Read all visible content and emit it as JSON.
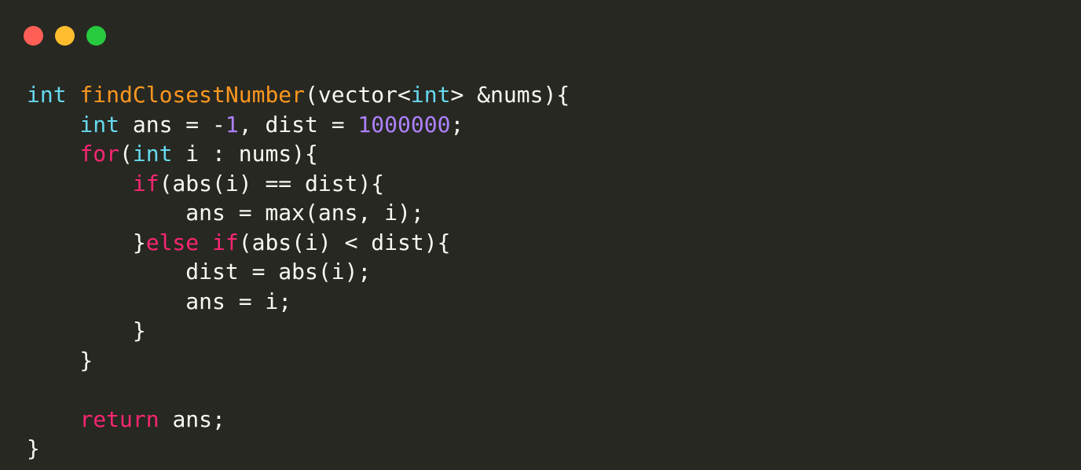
{
  "colors": {
    "background": "#272822",
    "text": "#f8f8f2",
    "type_keyword": "#66d9ef",
    "control_keyword": "#f92672",
    "function_name": "#fd971f",
    "number": "#ae81ff",
    "dot_close": "#ff5f56",
    "dot_minimize": "#ffbd2e",
    "dot_maximize": "#27c93f"
  },
  "code": {
    "lines": [
      [
        {
          "t": "int",
          "c": "kw-type"
        },
        {
          "t": " "
        },
        {
          "t": "findClosestNumber",
          "c": "fn"
        },
        {
          "t": "(vector<"
        },
        {
          "t": "int",
          "c": "kw-type"
        },
        {
          "t": "> &nums){"
        }
      ],
      [
        {
          "t": "    "
        },
        {
          "t": "int",
          "c": "kw-type"
        },
        {
          "t": " ans = -"
        },
        {
          "t": "1",
          "c": "num"
        },
        {
          "t": ", dist = "
        },
        {
          "t": "1000000",
          "c": "num"
        },
        {
          "t": ";"
        }
      ],
      [
        {
          "t": "    "
        },
        {
          "t": "for",
          "c": "kw-ctrl"
        },
        {
          "t": "("
        },
        {
          "t": "int",
          "c": "kw-type"
        },
        {
          "t": " i : nums){"
        }
      ],
      [
        {
          "t": "        "
        },
        {
          "t": "if",
          "c": "kw-ctrl"
        },
        {
          "t": "(abs(i) == dist){"
        }
      ],
      [
        {
          "t": "            ans = max(ans, i);"
        }
      ],
      [
        {
          "t": "        }"
        },
        {
          "t": "else",
          "c": "kw-ctrl"
        },
        {
          "t": " "
        },
        {
          "t": "if",
          "c": "kw-ctrl"
        },
        {
          "t": "(abs(i) < dist){"
        }
      ],
      [
        {
          "t": "            dist = abs(i);"
        }
      ],
      [
        {
          "t": "            ans = i;"
        }
      ],
      [
        {
          "t": "        }"
        }
      ],
      [
        {
          "t": "    }"
        }
      ],
      [
        {
          "t": ""
        }
      ],
      [
        {
          "t": "    "
        },
        {
          "t": "return",
          "c": "kw-ctrl"
        },
        {
          "t": " ans;"
        }
      ],
      [
        {
          "t": "}"
        }
      ]
    ]
  }
}
